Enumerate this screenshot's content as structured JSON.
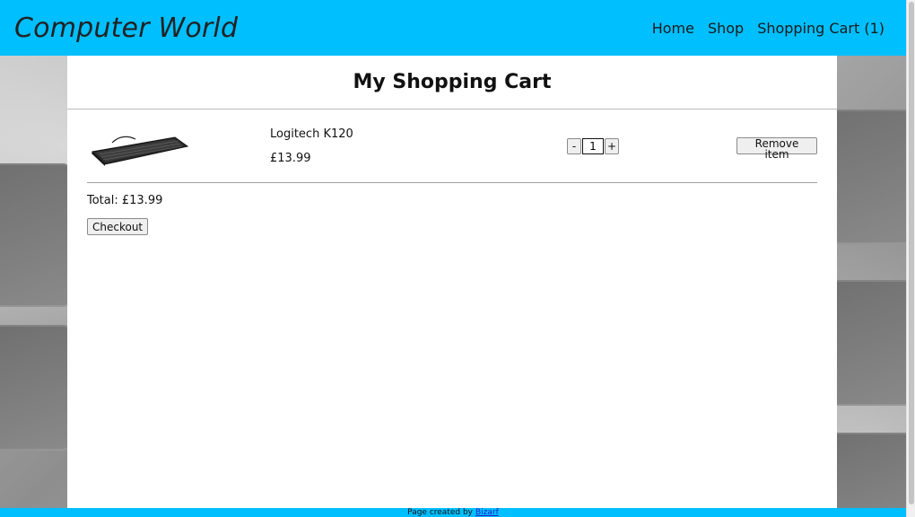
{
  "header": {
    "brand": "Computer World",
    "nav": [
      {
        "label": "Home"
      },
      {
        "label": "Shop"
      },
      {
        "label": "Shopping Cart (1)"
      }
    ]
  },
  "cart": {
    "title": "My Shopping Cart",
    "items": [
      {
        "name": "Logitech K120",
        "price": "£13.99",
        "quantity": "1",
        "decrement_label": "-",
        "increment_label": "+",
        "remove_label": "Remove item",
        "image_icon": "keyboard-image"
      }
    ],
    "total_label": "Total: £13.99",
    "checkout_label": "Checkout"
  },
  "footer": {
    "text": "Page created by",
    "link": "Bizarf"
  },
  "colors": {
    "accent": "#00bfff",
    "panel": "#ffffff"
  }
}
